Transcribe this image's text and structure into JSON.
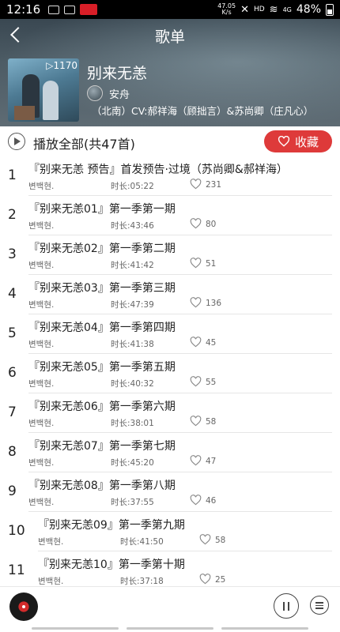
{
  "status_bar": {
    "time": "12:16",
    "speed": "47.05\nK/s",
    "network": "HD",
    "signal": "4G",
    "battery": "48%"
  },
  "header": {
    "title": "歌单",
    "album_title": "别来无恙",
    "play_count": "▷1170",
    "author": "安舟",
    "description": "（北南）CV:郝祥海（顾拙言）&苏尚卿（庄凡心）"
  },
  "actions": {
    "play_all": "播放全部(共47首)",
    "favorite": "收藏"
  },
  "colors": {
    "accent": "#de3a3a",
    "header_bg": "#56666f"
  },
  "tracks": [
    {
      "index": "1",
      "title": "『别来无恙 预告』首发预告·过境（苏尚卿&郝祥海）",
      "author": "변백현.",
      "duration": "时长:05:22",
      "likes": "231"
    },
    {
      "index": "2",
      "title": "『别来无恙01』第一季第一期",
      "author": "변백현.",
      "duration": "时长:43:46",
      "likes": "80"
    },
    {
      "index": "3",
      "title": "『别来无恙02』第一季第二期",
      "author": "변백현.",
      "duration": "时长:41:42",
      "likes": "51"
    },
    {
      "index": "4",
      "title": "『别来无恙03』第一季第三期",
      "author": "변백현.",
      "duration": "时长:47:39",
      "likes": "136"
    },
    {
      "index": "5",
      "title": "『别来无恙04』第一季第四期",
      "author": "변백현.",
      "duration": "时长:41:38",
      "likes": "45"
    },
    {
      "index": "6",
      "title": "『别来无恙05』第一季第五期",
      "author": "변백현.",
      "duration": "时长:40:32",
      "likes": "55"
    },
    {
      "index": "7",
      "title": "『别来无恙06』第一季第六期",
      "author": "변백현.",
      "duration": "时长:38:01",
      "likes": "58"
    },
    {
      "index": "8",
      "title": "『别来无恙07』第一季第七期",
      "author": "변백현.",
      "duration": "时长:45:20",
      "likes": "47"
    },
    {
      "index": "9",
      "title": "『别来无恙08』第一季第八期",
      "author": "변백현.",
      "duration": "时长:37:55",
      "likes": "46"
    },
    {
      "index": "10",
      "title": "『别来无恙09』第一季第九期",
      "author": "변백현.",
      "duration": "时长:41:50",
      "likes": "58"
    },
    {
      "index": "11",
      "title": "『别来无恙10』第一季第十期",
      "author": "변백현.",
      "duration": "时长:37:18",
      "likes": "25"
    }
  ]
}
